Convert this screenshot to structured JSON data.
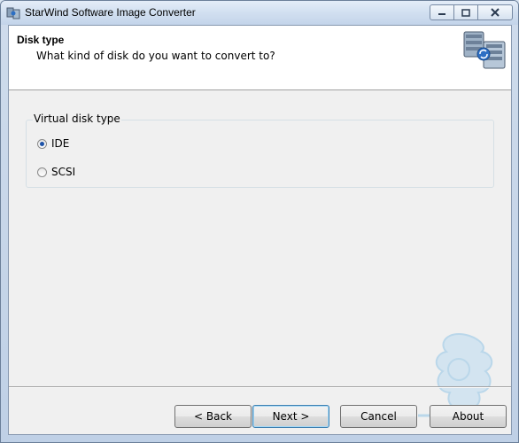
{
  "window": {
    "title": "StarWind Software Image Converter"
  },
  "header": {
    "title": "Disk type",
    "subtitle": "What kind of disk do you want to convert to?"
  },
  "group": {
    "label": "Virtual disk type",
    "options": [
      {
        "label": "IDE",
        "selected": true
      },
      {
        "label": "SCSI",
        "selected": false
      }
    ]
  },
  "buttons": {
    "back": "< Back",
    "next": "Next >",
    "cancel": "Cancel",
    "about": "About"
  },
  "colors": {
    "radio_selected": "#1c52a8",
    "default_button_border": "#3c7fb1"
  }
}
